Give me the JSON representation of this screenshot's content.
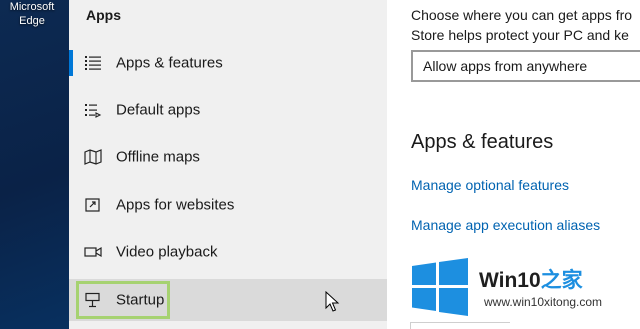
{
  "desktop": {
    "shortcut_line1": "Microsoft",
    "shortcut_line2": "Edge"
  },
  "nav": {
    "heading": "Apps",
    "items": [
      {
        "label": "Apps & features",
        "icon": "list-icon",
        "selected": true
      },
      {
        "label": "Default apps",
        "icon": "default-apps-icon"
      },
      {
        "label": "Offline maps",
        "icon": "map-icon"
      },
      {
        "label": "Apps for websites",
        "icon": "open-in-app-icon"
      },
      {
        "label": "Video playback",
        "icon": "video-icon"
      },
      {
        "label": "Startup",
        "icon": "startup-icon",
        "hovered": true
      }
    ]
  },
  "content": {
    "description_line1": "Choose where you can get apps fro",
    "description_line2": "Store helps protect your PC and ke",
    "dropdown_value": "Allow apps from anywhere",
    "section_title": "Apps & features",
    "link1": "Manage optional features",
    "link2": "Manage app execution aliases"
  },
  "watermark": {
    "brand_main": "Win10",
    "brand_accent": "之家",
    "url": "www.win10xitong.com"
  },
  "colors": {
    "accent": "#0078d7",
    "link": "#0063b1",
    "highlight_box": "#a6d271",
    "nav_bg": "#f0f0f0",
    "hover_bg": "#dadada"
  }
}
